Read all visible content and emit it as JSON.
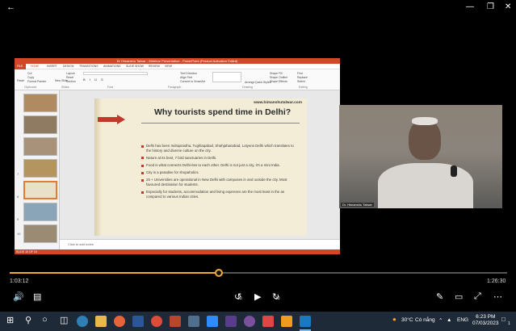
{
  "player": {
    "back_icon": "back-arrow-icon",
    "elapsed": "1:03:12",
    "duration": "1:26:30",
    "progress_fraction": 0.42,
    "skip_back_seconds": "10",
    "skip_forward_seconds": "30",
    "accent_color": "#f0a840"
  },
  "powerpoint": {
    "title": "Dr Himanshu Talwar - Webinar Presentation - PowerPoint (Product Activation Failed)",
    "file_tab": "FILE",
    "tabs": [
      "HOME",
      "INSERT",
      "DESIGN",
      "TRANSITIONS",
      "ANIMATIONS",
      "SLIDE SHOW",
      "REVIEW",
      "VIEW"
    ],
    "ribbon": {
      "paste": "Paste",
      "cut": "Cut",
      "copy": "Copy",
      "format_painter": "Format Painter",
      "new_slide": "New Slide",
      "layout": "Layout",
      "reset": "Reset",
      "section": "Section",
      "text_direction": "Text Direction",
      "align_text": "Align Text",
      "convert_smartart": "Convert to SmartArt",
      "arrange": "Arrange",
      "quick_styles": "Quick Styles",
      "shape_fill": "Shape Fill",
      "shape_outline": "Shape Outline",
      "shape_effects": "Shape Effects",
      "find": "Find",
      "replace": "Replace",
      "select": "Select",
      "groups": [
        "Clipboard",
        "Slides",
        "Font",
        "Paragraph",
        "Drawing",
        "Editing"
      ]
    },
    "thumb_numbers": [
      "7",
      "8",
      "9",
      "10",
      "11"
    ],
    "notes_placeholder": "Click to add notes",
    "status": "SLIDE 10 OF 15"
  },
  "slide": {
    "url": "www.himanshutalwar.com",
    "title": "Why tourists spend time in Delhi?",
    "bullets": [
      "Delhi has been Indraprastha, Tughlaqabad, Shahjahanabad, Lutyens Delhi which translates to the history and diverse culture on the city.",
      "Nature at its best, 7 bird sanctuaries in Delhi.",
      "Food is what connects Delhi-ites to each other. Delhi is not just a city, it's a mini India.",
      "City is a paradise for shopaholics.",
      "25 + Universities are operational in New Delhi with campuses in and outside the city. Most favoured destination for students.",
      "Especially for students, accommodation and living expenses are the most least in the as compared to various Indian cities."
    ]
  },
  "webcam": {
    "name_label": "Dr. Himanshu Talwar"
  },
  "taskbar": {
    "weather": "30°C",
    "weather_desc": "Có nắng",
    "language": "ENG",
    "time": "6:23 PM",
    "date": "07/03/2023",
    "notification_count": "1"
  }
}
